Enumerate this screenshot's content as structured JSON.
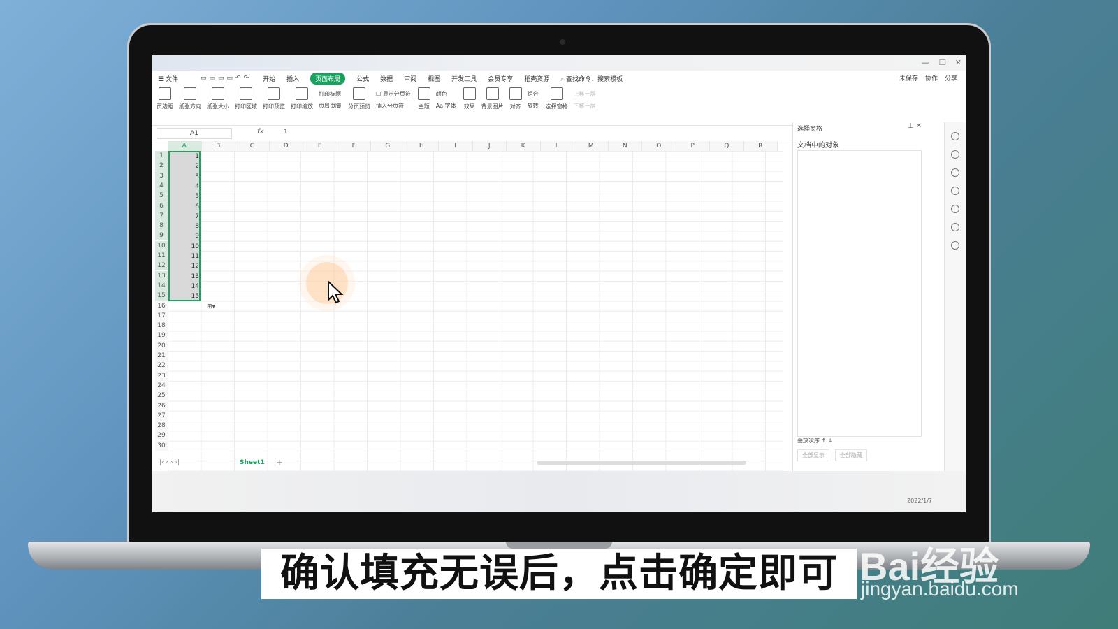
{
  "menu": {
    "file": "文件",
    "items": [
      "开始",
      "插入",
      "页面布局",
      "公式",
      "数据",
      "审阅",
      "视图",
      "开发工具",
      "会员专享",
      "稻壳资源"
    ],
    "search": "查找命令、搜索模板"
  },
  "right_tools": [
    "未保存",
    "协作",
    "分享"
  ],
  "ribbon": {
    "big": [
      "页边距",
      "纸张方向",
      "纸张大小",
      "打印区域",
      "打印预览",
      "打印缩放"
    ],
    "small1": [
      "打印标题",
      "页眉页脚"
    ],
    "big2": [
      "分页预览"
    ],
    "small2": [
      "显示分页符",
      "插入分页符"
    ],
    "big3": [
      "主题",
      "颜色",
      "效果",
      "背景图片"
    ],
    "small3": [
      "Aa 字体"
    ],
    "big4": [
      "对齐",
      "组合",
      "旋转",
      "选择窗格"
    ],
    "small4": [
      "上移一层",
      "下移一层"
    ]
  },
  "formula": {
    "name_box": "A1",
    "fx": "fx",
    "value": "1"
  },
  "columns": [
    "A",
    "B",
    "C",
    "D",
    "E",
    "F",
    "G",
    "H",
    "I",
    "J",
    "K",
    "L",
    "M",
    "N",
    "O",
    "P",
    "Q",
    "R"
  ],
  "rows": [
    "1",
    "2",
    "3",
    "4",
    "5",
    "6",
    "7",
    "8",
    "9",
    "10",
    "11",
    "12",
    "13",
    "14",
    "15",
    "16",
    "17",
    "18",
    "19",
    "20",
    "21",
    "22",
    "23",
    "24",
    "25",
    "26",
    "27",
    "28",
    "29",
    "30"
  ],
  "cell_values": [
    "1",
    "2",
    "3",
    "4",
    "5",
    "6",
    "7",
    "8",
    "9",
    "10",
    "11",
    "12",
    "13",
    "14",
    "15"
  ],
  "sheet_tab": "Sheet1",
  "pane": {
    "title": "选择窗格",
    "subtitle": "文档中的对象",
    "order": "叠放次序",
    "show_all": "全部显示",
    "hide_all": "全部隐藏"
  },
  "taskbar_date": "2022/1/7",
  "caption": "确认填充无误后，点击确定即可",
  "watermark": {
    "brand": "Bai经验",
    "url": "jingyan.baidu.com"
  },
  "colors": {
    "accent": "#1aa35f",
    "selection": "#d9d9d9"
  }
}
